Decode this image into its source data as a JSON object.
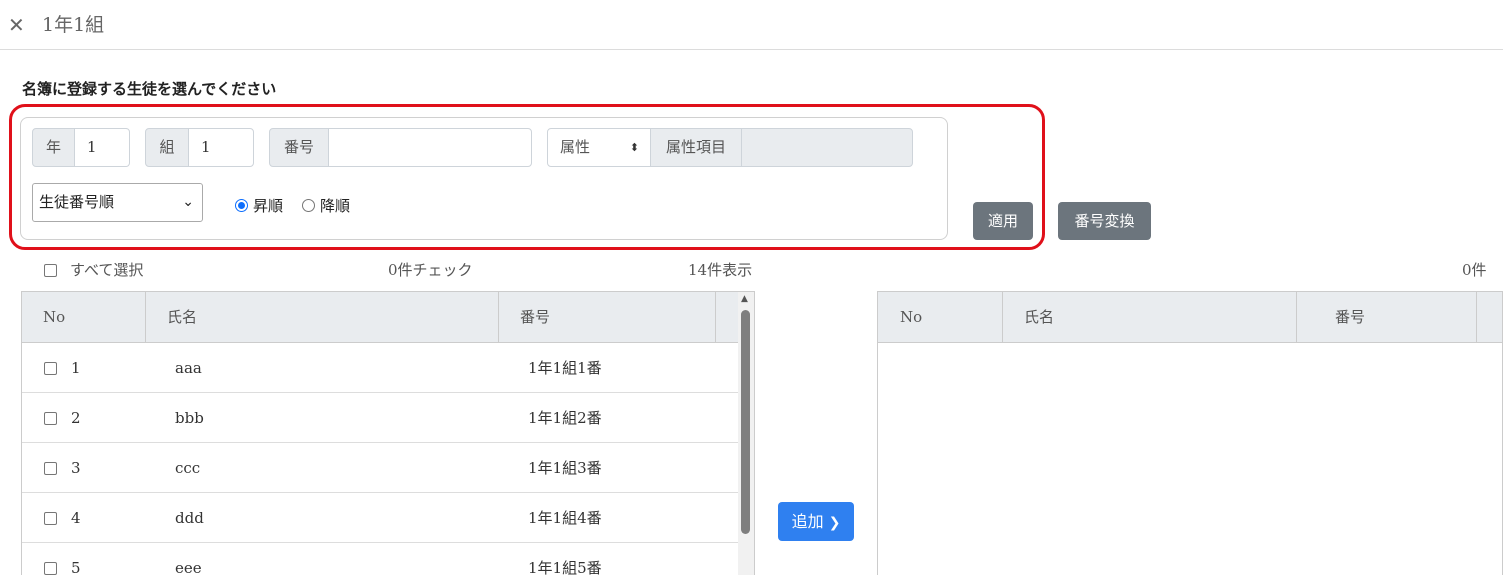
{
  "header": {
    "title": "1年1組",
    "close_icon": "✕"
  },
  "instruction": "名簿に登録する生徒を選んでください",
  "filters": {
    "year_label": "年",
    "year_value": "1",
    "class_label": "組",
    "class_value": "1",
    "number_label": "番号",
    "number_value": "",
    "attribute_select": "属性",
    "attribute_item_label": "属性項目",
    "attribute_item_value": "",
    "sort_select": "生徒番号順",
    "asc_label": "昇順",
    "desc_label": "降順",
    "sort_order": "asc"
  },
  "buttons": {
    "apply": "適用",
    "convert_number": "番号変換",
    "add": "追加"
  },
  "left_list": {
    "select_all_label": "すべて選択",
    "checked_count": "0件チェック",
    "shown_count": "14件表示",
    "columns": [
      "No",
      "氏名",
      "番号"
    ],
    "rows": [
      {
        "no": "1",
        "name": "aaa",
        "number": "1年1組1番"
      },
      {
        "no": "2",
        "name": "bbb",
        "number": "1年1組2番"
      },
      {
        "no": "3",
        "name": "ccc",
        "number": "1年1組3番"
      },
      {
        "no": "4",
        "name": "ddd",
        "number": "1年1組4番"
      },
      {
        "no": "5",
        "name": "eee",
        "number": "1年1組5番"
      }
    ]
  },
  "right_list": {
    "count": "0件",
    "columns": [
      "No",
      "氏名",
      "番号"
    ]
  },
  "colors": {
    "highlight": "#e0101a",
    "primary": "#2f80f0",
    "secondary": "#6c757d"
  }
}
